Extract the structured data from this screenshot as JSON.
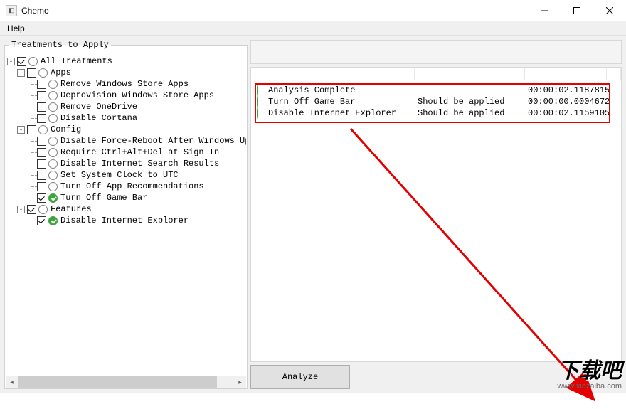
{
  "window": {
    "title": "Chemo",
    "iconHint": "form-icon"
  },
  "menu": {
    "help": "Help"
  },
  "leftPanel": {
    "legend": "Treatments to Apply",
    "tree": {
      "root": {
        "label": "All Treatments",
        "checked": true,
        "expanded": true,
        "children": [
          {
            "key": "apps",
            "label": "Apps",
            "checked": false,
            "expanded": true,
            "items": [
              {
                "label": "Remove Windows Store Apps",
                "checked": false,
                "ok": false
              },
              {
                "label": "Deprovision Windows Store Apps",
                "checked": false,
                "ok": false
              },
              {
                "label": "Remove OneDrive",
                "checked": false,
                "ok": false
              },
              {
                "label": "Disable Cortana",
                "checked": false,
                "ok": false
              }
            ]
          },
          {
            "key": "config",
            "label": "Config",
            "checked": false,
            "expanded": true,
            "items": [
              {
                "label": "Disable Force-Reboot After Windows Upd",
                "checked": false,
                "ok": false
              },
              {
                "label": "Require Ctrl+Alt+Del at Sign In",
                "checked": false,
                "ok": false
              },
              {
                "label": "Disable Internet Search Results",
                "checked": false,
                "ok": false
              },
              {
                "label": "Set System Clock to UTC",
                "checked": false,
                "ok": false
              },
              {
                "label": "Turn Off App Recommendations",
                "checked": false,
                "ok": false
              },
              {
                "label": "Turn Off Game Bar",
                "checked": true,
                "ok": true
              }
            ]
          },
          {
            "key": "features",
            "label": "Features",
            "checked": true,
            "expanded": true,
            "items": [
              {
                "label": "Disable Internet Explorer",
                "checked": true,
                "ok": true
              }
            ]
          }
        ]
      }
    }
  },
  "results": {
    "rows": [
      {
        "name": "Analysis Complete",
        "note": "",
        "time": "00:00:02.1187815"
      },
      {
        "name": "Turn Off Game Bar",
        "note": "Should be applied",
        "time": "00:00:00.0004672"
      },
      {
        "name": "Disable Internet Explorer",
        "note": "Should be applied",
        "time": "00:00:02.1159105"
      }
    ]
  },
  "buttons": {
    "analyze": "Analyze"
  },
  "watermark": {
    "big": "下载吧",
    "small": "www.xiazaiba.com"
  }
}
